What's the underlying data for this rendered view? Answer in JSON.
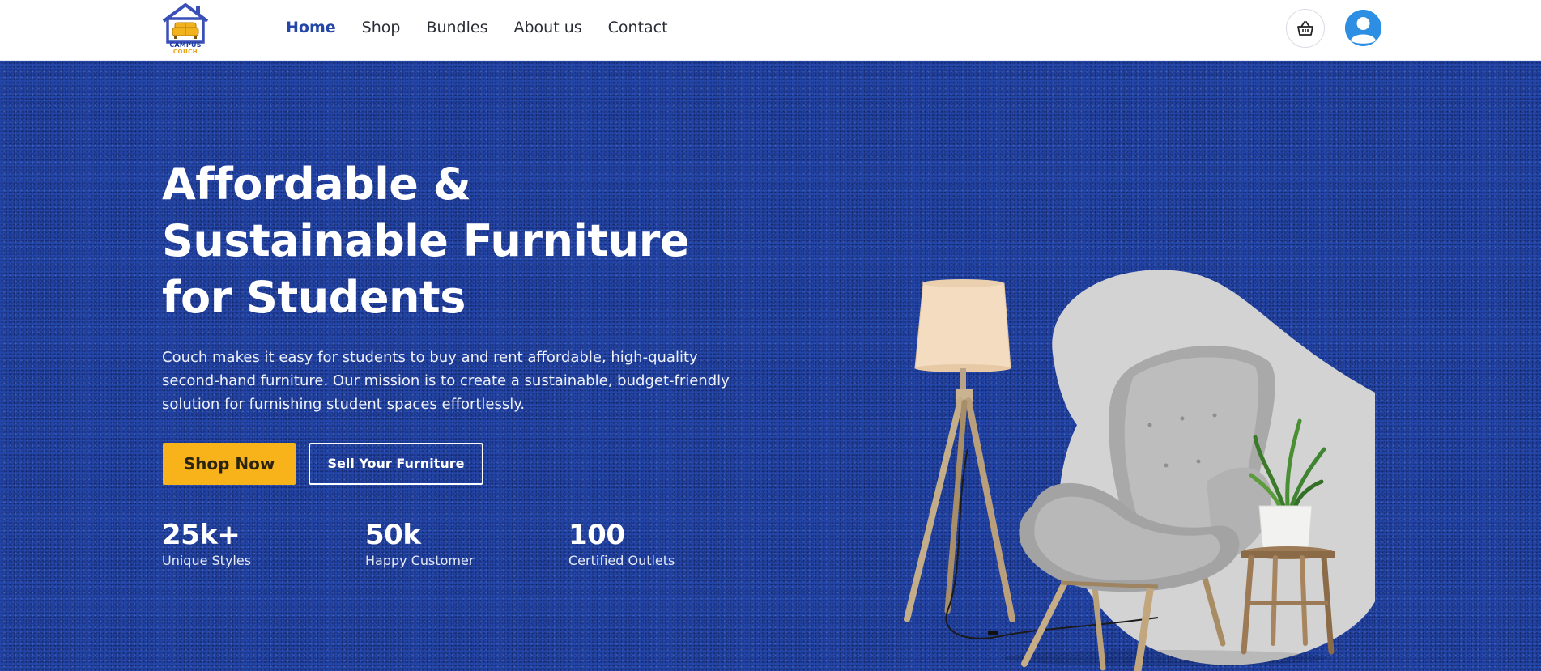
{
  "brand": {
    "logo_line1": "CAMPUS",
    "logo_line2": "COUCH",
    "colors": {
      "primary_blue": "#2446a8",
      "accent_yellow": "#f7b319"
    }
  },
  "nav": {
    "items": [
      {
        "label": "Home",
        "active": true
      },
      {
        "label": "Shop",
        "active": false
      },
      {
        "label": "Bundles",
        "active": false
      },
      {
        "label": "About us",
        "active": false
      },
      {
        "label": "Contact",
        "active": false
      }
    ]
  },
  "header_actions": {
    "cart_icon": "shopping-basket-icon",
    "profile_icon": "user-avatar-icon"
  },
  "hero": {
    "title_line1": "Affordable &",
    "title_line2": "Sustainable Furniture",
    "title_line3": "for Students",
    "description": "Couch makes it easy for students to buy and rent affordable, high-quality second-hand furniture. Our mission is to create a sustainable, budget-friendly solution for furnishing student spaces effortlessly.",
    "primary_cta": "Shop Now",
    "secondary_cta": "Sell Your Furniture",
    "stats": [
      {
        "value": "25k+",
        "label": "Unique Styles"
      },
      {
        "value": "50k",
        "label": "Happy Customer"
      },
      {
        "value": "100",
        "label": "Certified Outlets"
      }
    ]
  }
}
